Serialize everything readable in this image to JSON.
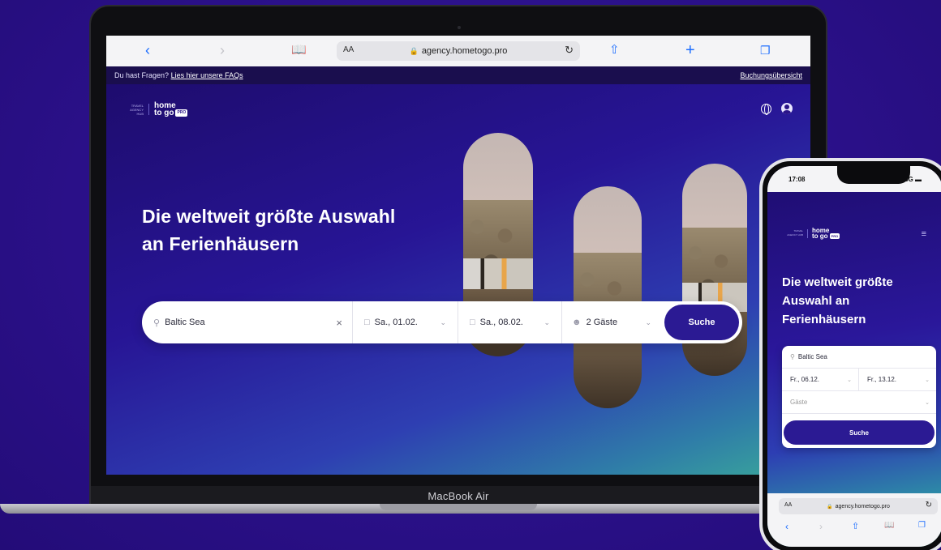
{
  "laptop": {
    "device_label": "MacBook Air",
    "browser": {
      "url": "agency.hometogo.pro",
      "aa": "AA",
      "icons": [
        "back-icon",
        "forward-icon",
        "book-icon",
        "reload-icon",
        "share-icon",
        "plus-icon",
        "tabs-icon"
      ]
    },
    "infobar": {
      "question": "Du hast Fragen?",
      "faq_link": "Lies hier unsere FAQs",
      "overview_link": "Buchungsübersicht"
    },
    "header": {
      "logo_small": "TRAVEL AGENCY HUB",
      "logo_top": "home",
      "logo_bottom": "to go",
      "logo_badge": "PRO"
    },
    "hero": {
      "headline_line1": "Die weltweit größte Auswahl",
      "headline_line2": "an Ferienhäusern"
    },
    "search": {
      "destination": "Baltic Sea",
      "checkin": "Sa., 01.02.",
      "checkout": "Sa., 08.02.",
      "guests": "2 Gäste",
      "button": "Suche"
    }
  },
  "phone": {
    "status_time": "17:08",
    "status_right": "5G",
    "header": {
      "logo_small": "TRAVEL AGENCY HUB",
      "logo_top": "home",
      "logo_bottom": "to go",
      "logo_badge": "PRO"
    },
    "headline_line1": "Die weltweit größte",
    "headline_line2": "Auswahl an",
    "headline_line3": "Ferienhäusern",
    "search": {
      "destination": "Baltic Sea",
      "checkin": "Fr., 06.12.",
      "checkout": "Fr., 13.12.",
      "guests_placeholder": "Gäste",
      "button": "Suche"
    },
    "browser": {
      "aa": "AA",
      "url": "agency.hometogo.pro"
    }
  },
  "colors": {
    "background": "#2c138f",
    "brand": "#2b1a93",
    "link_blue": "#1a6cff"
  }
}
